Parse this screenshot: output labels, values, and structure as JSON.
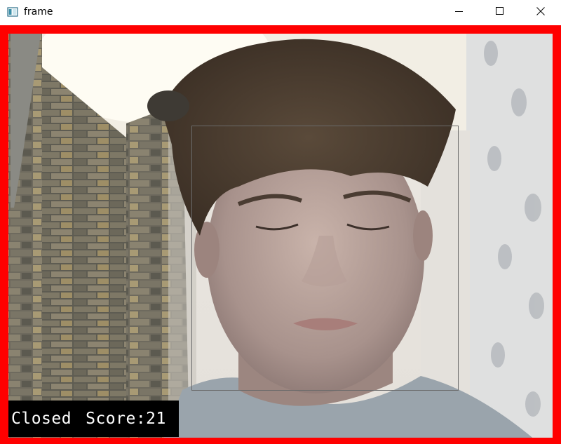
{
  "window": {
    "title": "frame",
    "controls": [
      "minimize-icon",
      "maximize-icon",
      "close-icon"
    ]
  },
  "overlay": {
    "status": "Closed",
    "score_label": "Score:21",
    "border_color": "#ff0000",
    "overlay_background": "#000000"
  }
}
